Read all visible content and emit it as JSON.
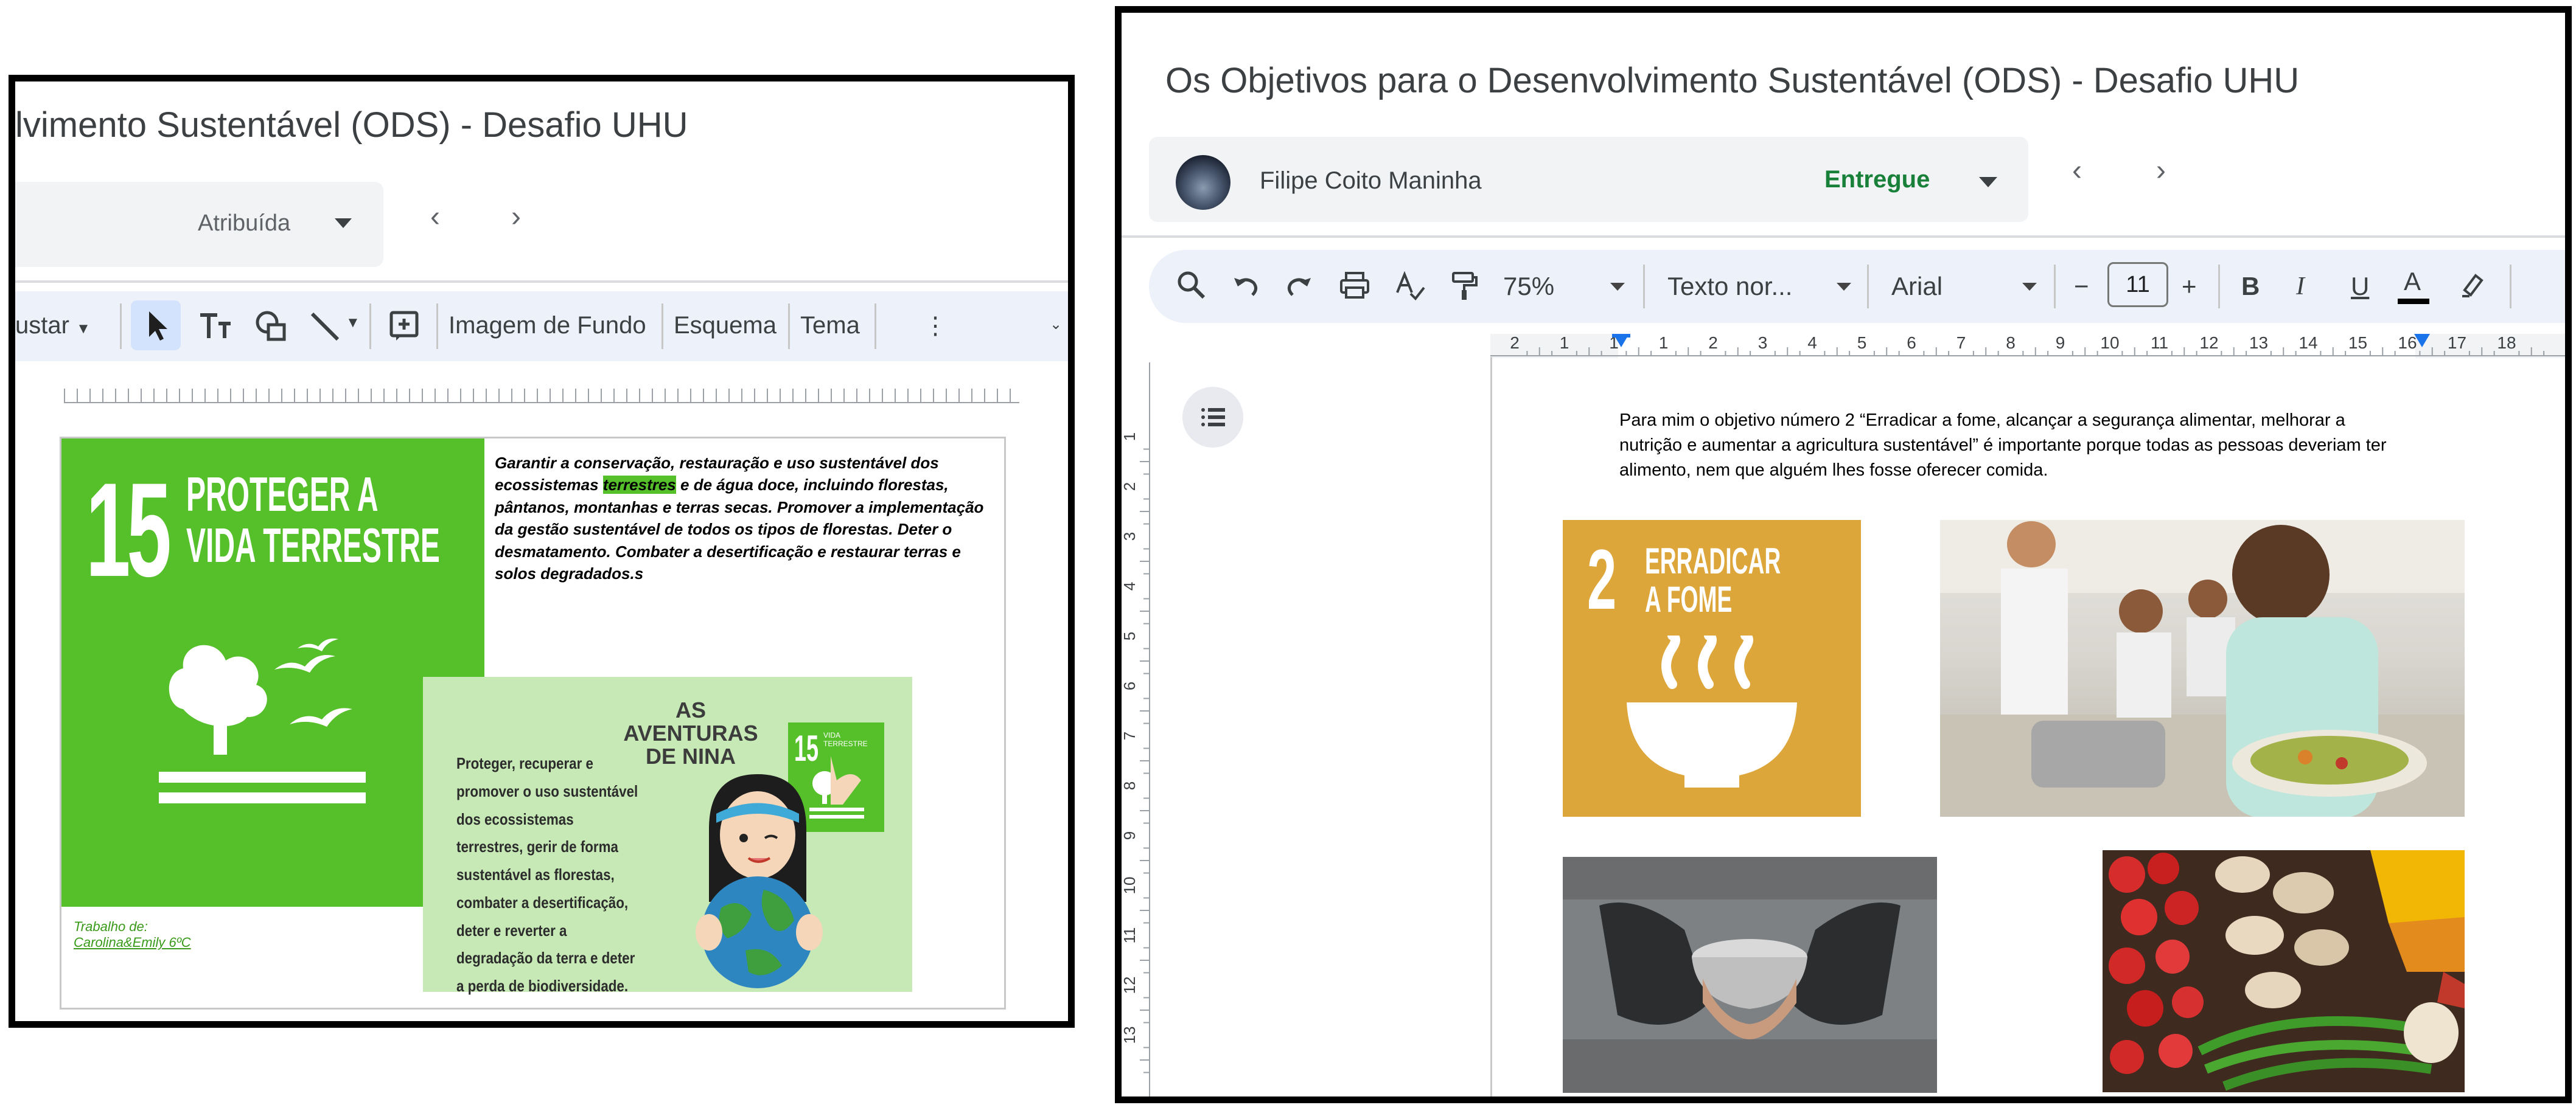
{
  "left_window": {
    "title": "lvimento Sustentável (ODS) - Desafio UHU",
    "status": "Atribuída",
    "nav_prev": "‹",
    "nav_next": "›",
    "toolbar": {
      "adjust": "ustar",
      "background_image": "Imagem de Fundo",
      "layout": "Esquema",
      "theme": "Tema",
      "more": "⋮"
    },
    "slide": {
      "sdg_number": "15",
      "sdg_title_line1": "PROTEGER A",
      "sdg_title_line2": "VIDA TERRESTRE",
      "text_before": "Garantir a conservação, restauração e uso sustentável dos ecossistemas ",
      "text_highlight": "terrestres",
      "text_after": " e de água doce, incluindo florestas, pântanos, montanhas e terras secas. Promover a implementação da gestão sustentável de todos os tipos de florestas. Deter o desmatamento. Combater a desertificação e restaurar terras e solos degradados.s",
      "comic_title_line1": "AS AVENTURAS",
      "comic_title_line2": "DE NINA",
      "comic_text": "Proteger, recuperar e promover o uso sustentável dos ecossistemas terrestres, gerir de forma sustentável as florestas, combater a desertificação, deter e reverter a degradação da terra e deter a perda de biodiversidade.",
      "comic_badge_number": "15",
      "comic_badge_label": "VIDA TERRESTRE",
      "credit_line1": "Trabalho de:",
      "credit_line2": "Carolina&Emily 6ºC"
    }
  },
  "right_window": {
    "title": "Os Objetivos para o Desenvolvimento Sustentável (ODS) - Desafio UHU",
    "user_name": "Filipe Coito Maninha",
    "status": "Entregue",
    "nav_prev": "‹",
    "nav_next": "›",
    "toolbar": {
      "zoom": "75%",
      "style": "Texto nor...",
      "font": "Arial",
      "minus": "−",
      "font_size": "11",
      "plus": "+",
      "bold": "B",
      "italic": "I",
      "underline": "U",
      "text_color": "A"
    },
    "ruler_numbers": [
      "2",
      "1",
      "1",
      "1",
      "2",
      "3",
      "4",
      "5",
      "6",
      "7",
      "8",
      "9",
      "10",
      "11",
      "12",
      "13",
      "14",
      "15",
      "16",
      "17",
      "18"
    ],
    "vruler_numbers": [
      "1",
      "2",
      "3",
      "4",
      "5",
      "6",
      "7",
      "8",
      "9",
      "10",
      "11",
      "12",
      "13"
    ],
    "doc_text": "Para mim o objetivo número 2 “Erradicar a fome, alcançar a segurança alimentar, melhorar a nutrição e aumentar a agricultura sustentável” é importante porque todas as pessoas deveriam ter alimento, nem que alguém lhes fosse oferecer comida.",
    "sdg2_number": "2",
    "sdg2_title_line1": "ERRADICAR",
    "sdg2_title_line2": "A FOME"
  },
  "colors": {
    "sdg15_green": "#56c02b",
    "sdg2_gold": "#dda63a",
    "status_green": "#188038"
  }
}
